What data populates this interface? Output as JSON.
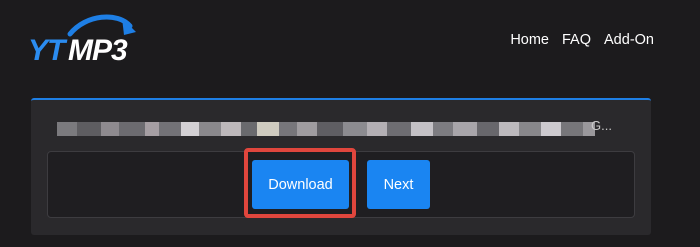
{
  "header": {
    "logo_text": "YTMP3",
    "nav": [
      {
        "label": "Home"
      },
      {
        "label": "FAQ"
      },
      {
        "label": "Add-On"
      }
    ]
  },
  "result": {
    "title_visible_suffix": "G..."
  },
  "actions": {
    "download_label": "Download",
    "next_label": "Next"
  },
  "colors": {
    "background": "#1c1b1d",
    "card": "#2a292c",
    "accent": "#1a85f2",
    "highlight": "#e0463d"
  }
}
